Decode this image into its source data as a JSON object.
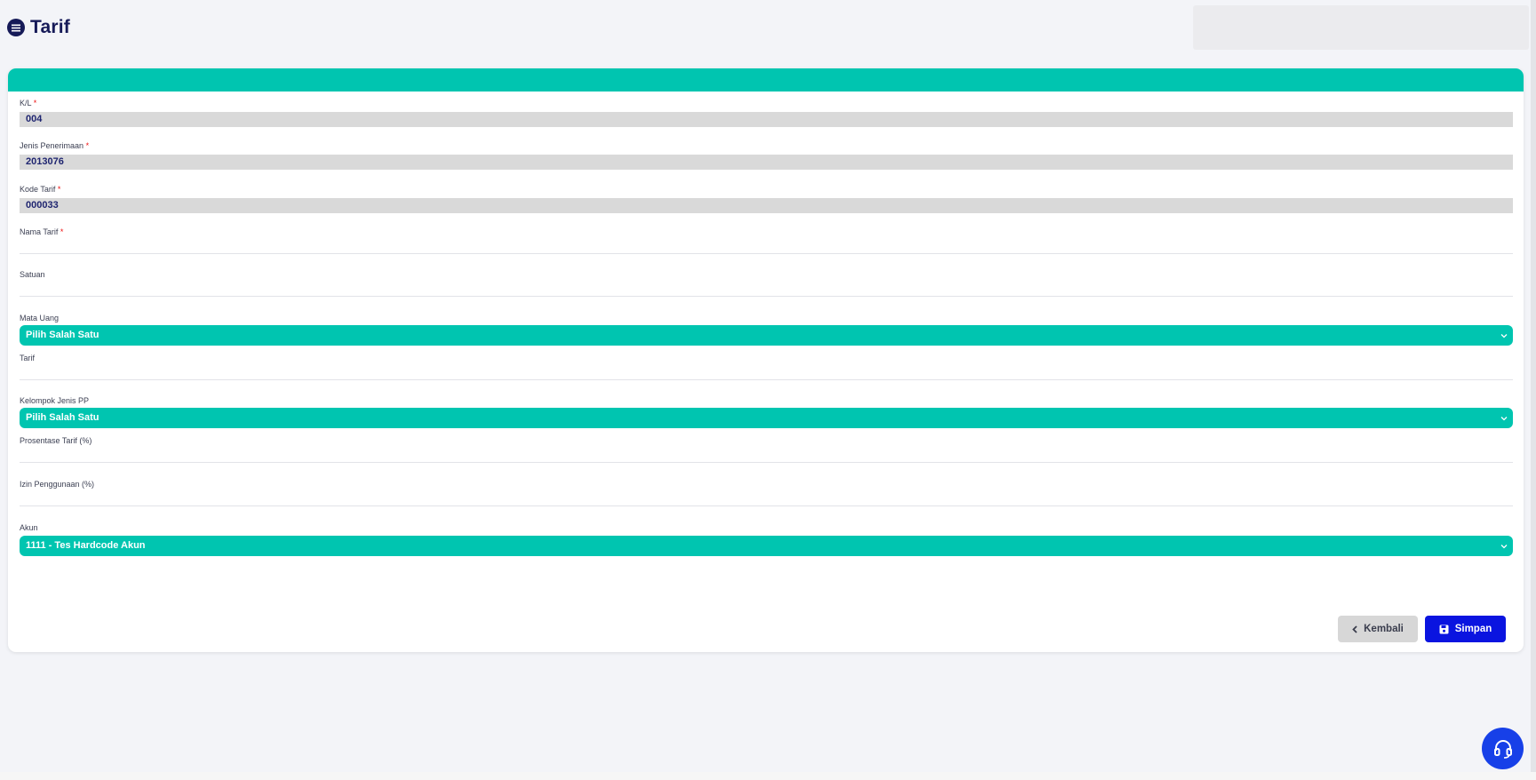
{
  "header": {
    "title": "Tarif"
  },
  "form": {
    "kl": {
      "label": "K/L",
      "required": "*",
      "value": "004"
    },
    "jenis_penerimaan": {
      "label": "Jenis Penerimaan",
      "required": "*",
      "value": "2013076"
    },
    "kode_tarif": {
      "label": "Kode Tarif",
      "required": "*",
      "value": "000033"
    },
    "nama_tarif": {
      "label": "Nama Tarif",
      "required": "*",
      "value": ""
    },
    "satuan": {
      "label": "Satuan",
      "value": ""
    },
    "mata_uang": {
      "label": "Mata Uang",
      "selected": "Pilih Salah Satu"
    },
    "tarif": {
      "label": "Tarif",
      "value": ""
    },
    "kelompok_jenis_pp": {
      "label": "Kelompok Jenis PP",
      "selected": "Pilih Salah Satu"
    },
    "prosentase_tarif": {
      "label": "Prosentase Tarif (%)",
      "value": ""
    },
    "izin_penggunaan": {
      "label": "Izin Penggunaan (%)",
      "value": ""
    },
    "akun": {
      "label": "Akun",
      "selected": "1111 - Tes Hardcode Akun"
    }
  },
  "actions": {
    "back_label": "Kembali",
    "save_label": "Simpan"
  },
  "icons": {
    "title": "list-circle-icon",
    "back": "chevron-left-icon",
    "save": "floppy-disk-icon",
    "dropdown": "chevron-down-icon",
    "help": "headset-icon"
  },
  "colors": {
    "accent": "#00c5b0",
    "title": "#161a58",
    "primary_button": "#0a14e0",
    "secondary_button": "#d7d7d7",
    "readonly_field": "#d9d9d9",
    "required_marker": "#e11111",
    "help_button": "#1740e8"
  }
}
